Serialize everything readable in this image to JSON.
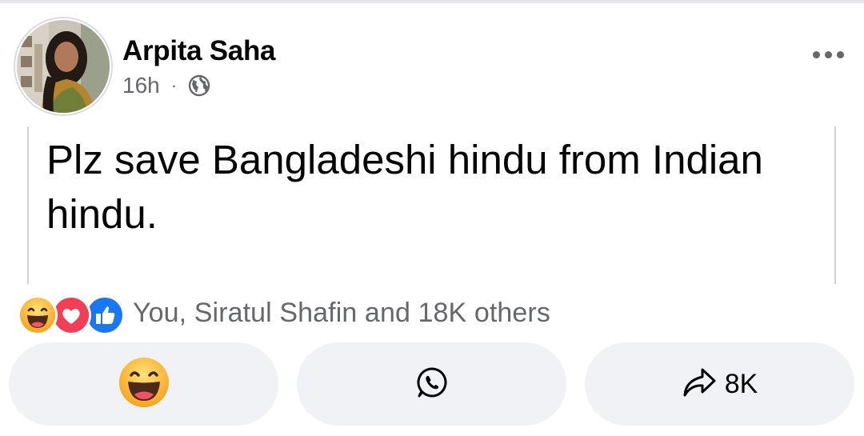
{
  "post": {
    "author": "Arpita Saha",
    "time": "16h",
    "separator": "·",
    "privacy_icon": "globe-icon",
    "text": "Plz save Bangladeshi hindu from Indian hindu.",
    "more_icon": "more-options-icon"
  },
  "reactions": {
    "icons": [
      "haha-reaction-icon",
      "love-reaction-icon",
      "like-reaction-icon"
    ],
    "summary": "You, Siratul Shafin and 18K others"
  },
  "actions": {
    "react_icon": "haha-reaction-icon",
    "whatsapp_icon": "whatsapp-icon",
    "share_icon": "share-arrow-icon",
    "share_count": "8K"
  },
  "colors": {
    "like_blue": "#1877f2",
    "love_red": "#f33e58",
    "haha_yellow": "#f7b125",
    "button_bg": "#f0f2f5",
    "secondary_text": "#65676b"
  }
}
